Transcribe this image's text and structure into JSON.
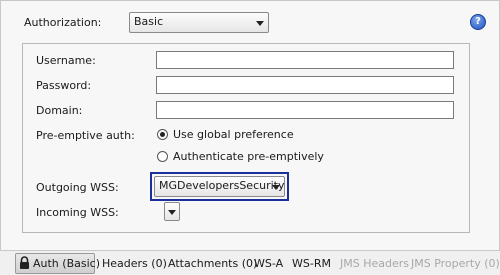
{
  "authorization": {
    "label": "Authorization:",
    "selected": "Basic"
  },
  "fields": {
    "username_label": "Username:",
    "password_label": "Password:",
    "domain_label": "Domain:",
    "username_value": "",
    "password_value": "",
    "domain_value": ""
  },
  "preemptive": {
    "label": "Pre-emptive auth:",
    "option_global": "Use global preference",
    "option_preemptive": "Authenticate pre-emptively",
    "selected": "option_global"
  },
  "wss": {
    "outgoing_label": "Outgoing WSS:",
    "outgoing_selected": "MGDevelopersSecurity",
    "incoming_label": "Incoming WSS:",
    "incoming_selected": ""
  },
  "tabs": [
    {
      "label": "Auth (Basic)",
      "active": true,
      "enabled": true
    },
    {
      "label": "Headers (0)",
      "active": false,
      "enabled": true
    },
    {
      "label": "Attachments (0)",
      "active": false,
      "enabled": true
    },
    {
      "label": "WS-A",
      "active": false,
      "enabled": true
    },
    {
      "label": "WS-RM",
      "active": false,
      "enabled": true
    },
    {
      "label": "JMS Headers",
      "active": false,
      "enabled": false
    },
    {
      "label": "JMS Property (0)",
      "active": false,
      "enabled": false
    }
  ],
  "help_icon": "help-icon",
  "colors": {
    "focus_ring": "#1a2f9c",
    "disabled_text": "#a8a8a8"
  }
}
